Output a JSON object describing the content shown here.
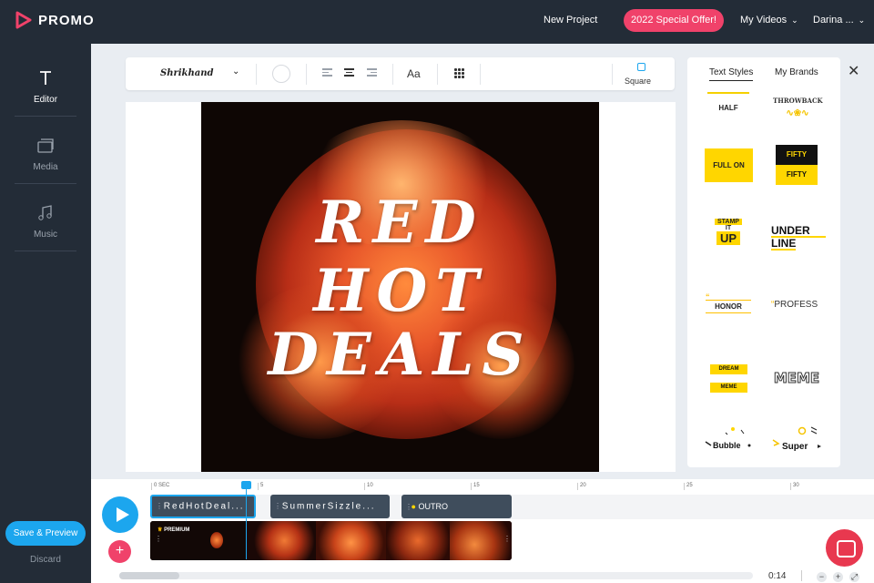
{
  "brand": {
    "name": "PROMO",
    "accent": "#f0426a",
    "blue": "#1ca6ee"
  },
  "topnav": {
    "new_project": "New Project",
    "offer": "2022 Special Offer!",
    "my_videos": "My Videos",
    "user": "Darina ..."
  },
  "sidebar": {
    "items": [
      {
        "label": "Editor",
        "icon": "text-tool-icon"
      },
      {
        "label": "Media",
        "icon": "media-icon"
      },
      {
        "label": "Music",
        "icon": "music-note-icon"
      }
    ],
    "save": "Save & Preview",
    "discard": "Discard"
  },
  "toolbar": {
    "font": "Shrikhand",
    "aa": "Aa",
    "ratio": "Square"
  },
  "canvas": {
    "lines": [
      "RED",
      "HOT",
      "DEALS"
    ]
  },
  "panel": {
    "tabs": [
      "Text Styles",
      "My Brands"
    ],
    "styles": [
      "HALF",
      "THROWBACK",
      "FULL ON",
      "FIFTY",
      "FIFTY",
      "STAMP",
      "IT",
      "UP",
      "UNDER",
      "LINE",
      "HONOR",
      "PROFESS",
      "DREAM",
      "MEME",
      "MEME",
      "Bubble",
      "Super"
    ]
  },
  "timeline": {
    "ticks": [
      "0 SEC",
      "5",
      "10",
      "15",
      "20",
      "25",
      "30"
    ],
    "clips": [
      "RedHotDeal...",
      "SummerSizzle...",
      "OUTRO"
    ],
    "premium": "PREMIUM",
    "duration": "0:14"
  }
}
